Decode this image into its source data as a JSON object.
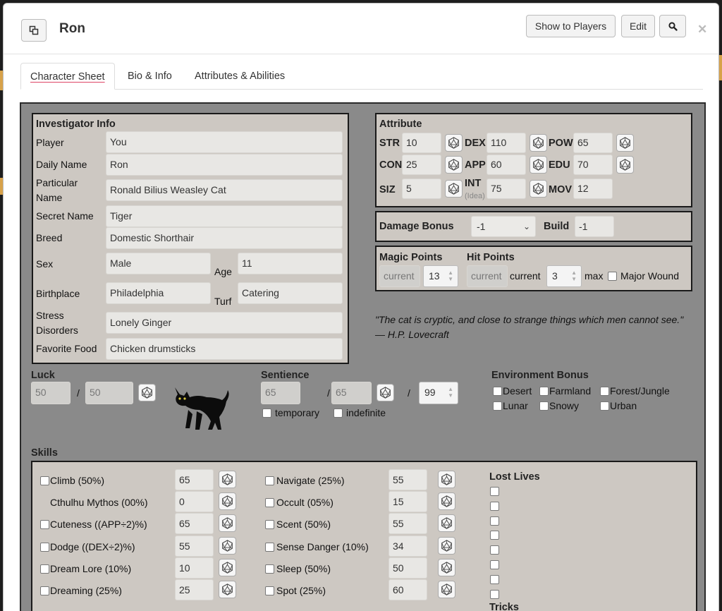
{
  "window": {
    "title": "Ron",
    "buttons": {
      "show": "Show to Players",
      "edit": "Edit"
    }
  },
  "tabs": [
    "Character Sheet",
    "Bio & Info",
    "Attributes & Abilities"
  ],
  "info": {
    "heading": "Investigator Info",
    "player_label": "Player",
    "player": "You",
    "daily_label": "Daily Name",
    "daily": "Ron",
    "particular_label1": "Particular",
    "particular_label2": "Name",
    "particular": "Ronald Bilius Weasley Cat",
    "secret_label": "Secret Name",
    "secret": "Tiger",
    "breed_label": "Breed",
    "breed": "Domestic Shorthair",
    "sex_label": "Sex",
    "sex": "Male",
    "age_label": "Age",
    "age": "11",
    "birth_label": "Birthplace",
    "birth": "Philadelphia",
    "turf_label": "Turf",
    "turf": "Catering",
    "stress_label1": "Stress",
    "stress_label2": "Disorders",
    "stress": "Lonely Ginger",
    "food_label": "Favorite Food",
    "food": "Chicken drumsticks"
  },
  "attr": {
    "heading": "Attribute",
    "str_l": "STR",
    "str": "10",
    "dex_l": "DEX",
    "dex": "110",
    "pow_l": "POW",
    "pow": "65",
    "con_l": "CON",
    "con": "25",
    "app_l": "APP",
    "app": "60",
    "edu_l": "EDU",
    "edu": "70",
    "siz_l": "SIZ",
    "siz": "5",
    "int_l": "INT",
    "int_sub": "(Idea)",
    "int": "75",
    "mov_l": "MOV",
    "mov": "12"
  },
  "damage": {
    "label": "Damage Bonus",
    "value": "-1",
    "build_label": "Build",
    "build": "-1"
  },
  "points": {
    "magic_label": "Magic Points",
    "hit_label": "Hit Points",
    "current_ph": "current",
    "current_label": "current",
    "magic": "13",
    "hit": "3",
    "max_label": "max",
    "wound_label": "Major Wound"
  },
  "quote": "\"The cat is cryptic, and close to strange things which men cannot see.\" — H.P. Lovecraft",
  "luck": {
    "label": "Luck",
    "current": "50",
    "slash": "/",
    "max": "50"
  },
  "sentience": {
    "label": "Sentience",
    "current": "65",
    "slash": "/",
    "max": "65",
    "slash2": "/",
    "limit": "99",
    "temporary": "temporary",
    "indefinite": "indefinite"
  },
  "env": {
    "label": "Environment Bonus",
    "items": [
      "Desert",
      "Farmland",
      "Forest/Jungle",
      "Lunar",
      "Snowy",
      "Urban"
    ]
  },
  "skills": {
    "label": "Skills",
    "left": [
      {
        "name": "Climb (50%)",
        "value": "65"
      },
      {
        "name": "Cthulhu Mythos (00%)",
        "value": "0"
      },
      {
        "name": "Cuteness ((APP÷2)%)",
        "value": "65"
      },
      {
        "name": "Dodge ((DEX÷2)%)",
        "value": "55"
      },
      {
        "name": "Dream Lore (10%)",
        "value": "10"
      },
      {
        "name": "Dreaming (25%)",
        "value": "25"
      }
    ],
    "right": [
      {
        "name": "Navigate (25%)",
        "value": "55"
      },
      {
        "name": "Occult (05%)",
        "value": "15"
      },
      {
        "name": "Scent (50%)",
        "value": "55"
      },
      {
        "name": "Sense Danger (10%)",
        "value": "34"
      },
      {
        "name": "Sleep (50%)",
        "value": "50"
      },
      {
        "name": "Spot (25%)",
        "value": "60"
      }
    ],
    "lost_lives": "Lost Lives",
    "tricks": "Tricks"
  },
  "colors": {
    "sheet_bg": "#8a8a8a",
    "box_bg": "#cdc8c2",
    "underline": "#dd4466"
  }
}
